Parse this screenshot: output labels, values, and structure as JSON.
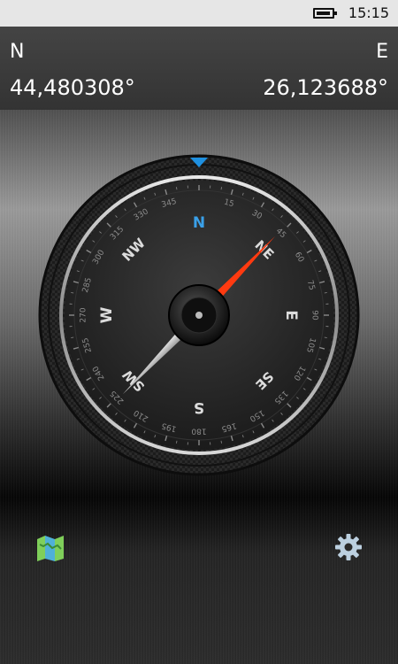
{
  "status_bar": {
    "time": "15:15",
    "battery_icon": "battery-icon"
  },
  "coordinates": {
    "latitude_label": "N",
    "latitude_value": "44,480308°",
    "longitude_label": "E",
    "longitude_value": "26,123688°"
  },
  "compass": {
    "cardinals": [
      "N",
      "NE",
      "E",
      "SE",
      "S",
      "SW",
      "W",
      "NW"
    ],
    "degree_labels": [
      "15",
      "30",
      "45",
      "60",
      "75",
      "90",
      "105",
      "120",
      "135",
      "150",
      "165",
      "180",
      "195",
      "210",
      "225",
      "240",
      "255",
      "270",
      "285",
      "300",
      "315",
      "330",
      "345"
    ],
    "heading_degrees": 44,
    "north_color": "#3aa0e8",
    "needle_color": "#ff3a10",
    "marker_color": "#1e90e0"
  },
  "bottom_bar": {
    "map_icon": "map-icon",
    "settings_icon": "gear-icon"
  }
}
